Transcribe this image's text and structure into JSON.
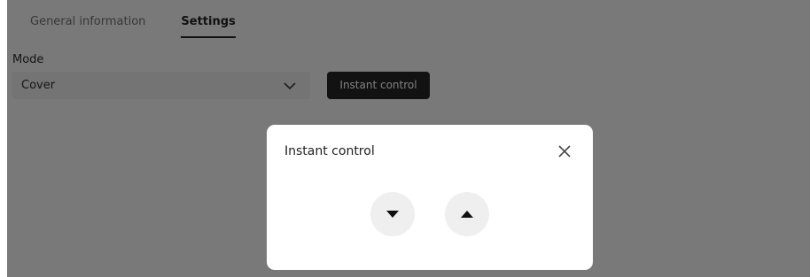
{
  "tabs": [
    {
      "label": "General information"
    },
    {
      "label": "Settings"
    }
  ],
  "mode": {
    "label": "Mode",
    "selected": "Cover"
  },
  "actions": {
    "instant_control_label": "Instant control"
  },
  "modal": {
    "title": "Instant control",
    "controls": {
      "down_icon": "caret-down-icon",
      "up_icon": "caret-up-icon"
    }
  },
  "colors": {
    "page_background": "#f3f3f3",
    "overlay": "rgba(0,0,0,0.5)",
    "primary_button": "#242424",
    "control_circle": "#efefef"
  }
}
